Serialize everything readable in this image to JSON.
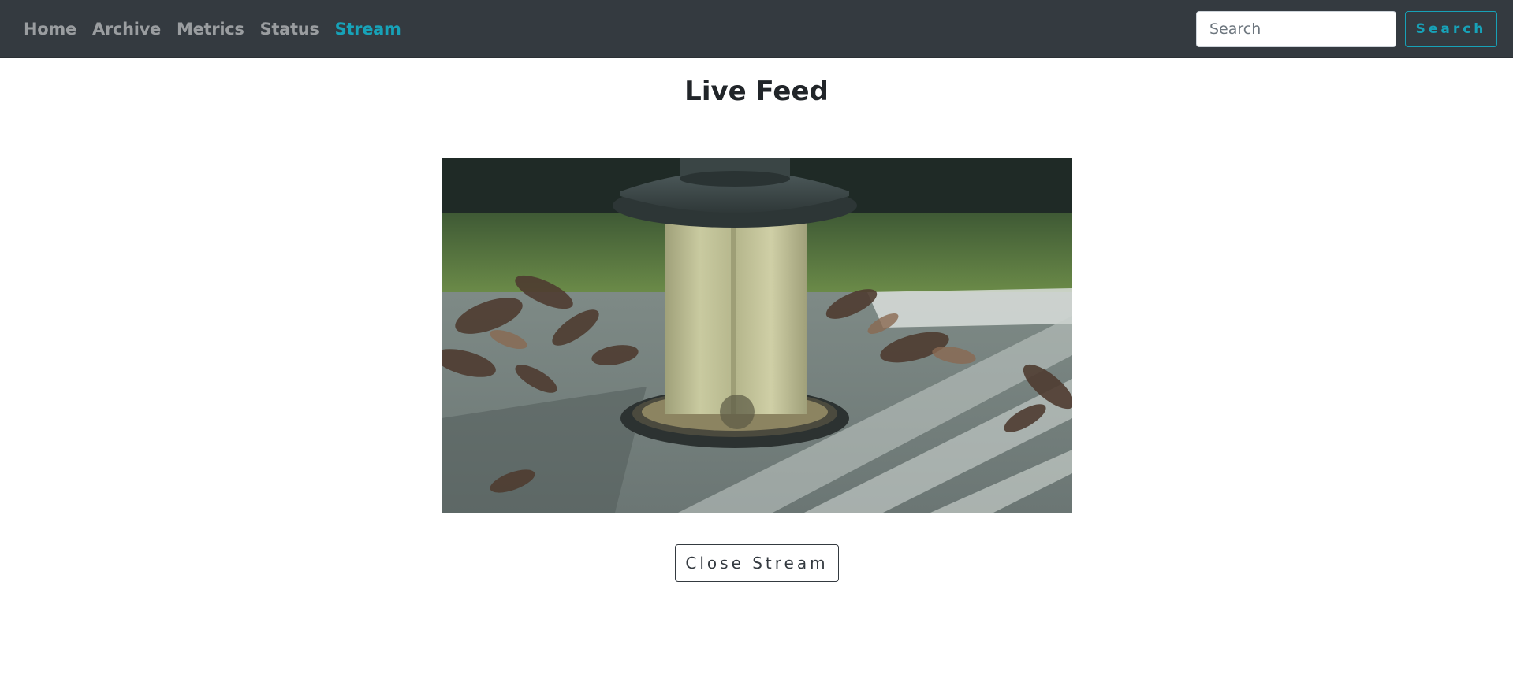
{
  "nav": {
    "links": [
      {
        "label": "Home"
      },
      {
        "label": "Archive"
      },
      {
        "label": "Metrics"
      },
      {
        "label": "Status"
      },
      {
        "label": "Stream"
      }
    ],
    "active": "Stream",
    "search_placeholder": "Search",
    "search_button_label": "Search"
  },
  "main": {
    "title": "Live Feed",
    "close_button_label": "Close Stream"
  },
  "colors": {
    "navbar_bg": "#343a40",
    "nav_link": "#9a9da0",
    "accent": "#17a2b8",
    "title": "#212529"
  }
}
